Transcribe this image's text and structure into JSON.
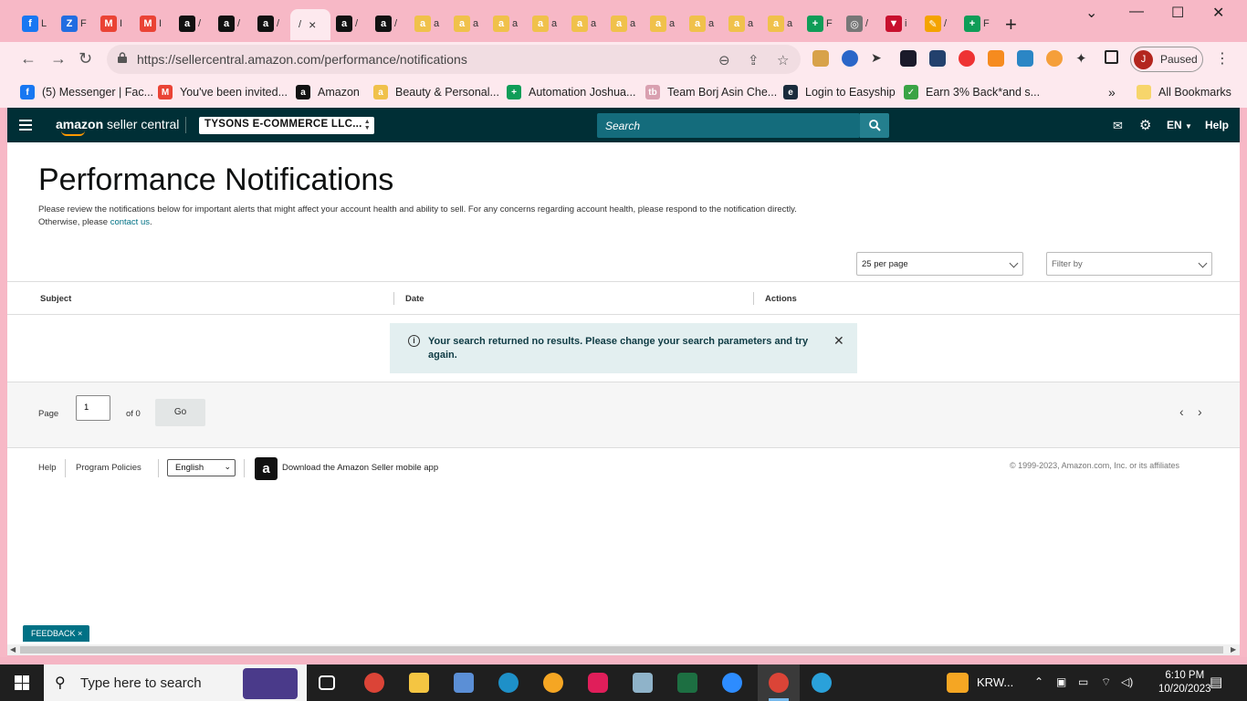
{
  "browser": {
    "tabs": [
      {
        "icon": "facebook-icon",
        "label": "L",
        "color": "#1877f2",
        "glyph": "f"
      },
      {
        "icon": "zoho-icon",
        "label": "F",
        "color": "#226de1",
        "glyph": "Z"
      },
      {
        "icon": "gmail-icon",
        "label": "I",
        "color": "#ea4335",
        "glyph": "M"
      },
      {
        "icon": "gmail-icon",
        "label": "I",
        "color": "#ea4335",
        "glyph": "M"
      },
      {
        "icon": "amazon-icon",
        "label": "/",
        "color": "#111111",
        "glyph": "a"
      },
      {
        "icon": "amazon-icon",
        "label": "/",
        "color": "#111111",
        "glyph": "a"
      },
      {
        "icon": "amazon-icon",
        "label": "/",
        "color": "#111111",
        "glyph": "a"
      },
      {
        "icon": "amazon-icon",
        "label": "/",
        "color": "#111111",
        "glyph": "a"
      },
      {
        "icon": "amazon-icon",
        "label": "/",
        "color": "#111111",
        "glyph": "a"
      },
      {
        "icon": "amazon-smile-icon",
        "label": "a",
        "color": "#f0c14b",
        "glyph": "a"
      },
      {
        "icon": "amazon-smile-icon",
        "label": "a",
        "color": "#f0c14b",
        "glyph": "a"
      },
      {
        "icon": "amazon-smile-icon",
        "label": "a",
        "color": "#f0c14b",
        "glyph": "a"
      },
      {
        "icon": "amazon-smile-icon",
        "label": "a",
        "color": "#f0c14b",
        "glyph": "a"
      },
      {
        "icon": "amazon-smile-icon",
        "label": "a",
        "color": "#f0c14b",
        "glyph": "a"
      },
      {
        "icon": "amazon-smile-icon",
        "label": "a",
        "color": "#f0c14b",
        "glyph": "a"
      },
      {
        "icon": "amazon-smile-icon",
        "label": "a",
        "color": "#f0c14b",
        "glyph": "a"
      },
      {
        "icon": "amazon-smile-icon",
        "label": "a",
        "color": "#f0c14b",
        "glyph": "a"
      },
      {
        "icon": "amazon-smile-icon",
        "label": "a",
        "color": "#f0c14b",
        "glyph": "a"
      },
      {
        "icon": "amazon-smile-icon",
        "label": "a",
        "color": "#f0c14b",
        "glyph": "a"
      },
      {
        "icon": "sheets-icon",
        "label": "F",
        "color": "#0f9d58",
        "glyph": "+"
      },
      {
        "icon": "globe-icon",
        "label": "/",
        "color": "#777777",
        "glyph": "◎"
      },
      {
        "icon": "tabs-icon",
        "label": "i",
        "color": "#c8102e",
        "glyph": "▼"
      },
      {
        "icon": "pencil-icon",
        "label": "/",
        "color": "#f4a300",
        "glyph": "✎"
      },
      {
        "icon": "sheets-icon",
        "label": "F",
        "color": "#0f9d58",
        "glyph": "+"
      }
    ],
    "active_tab_close": "×",
    "new_tab": "+",
    "url": "https://sellercentral.amazon.com/performance/notifications",
    "profile_initial": "J",
    "profile_status": "Paused",
    "bookmarks": [
      {
        "label": "(5) Messenger | Fac...",
        "icon": "facebook-icon",
        "color": "#1877f2",
        "glyph": "f"
      },
      {
        "label": "You've been invited...",
        "icon": "gmail-icon",
        "color": "#ea4335",
        "glyph": "M"
      },
      {
        "label": "Amazon",
        "icon": "amazon-icon",
        "color": "#111111",
        "glyph": "a"
      },
      {
        "label": "Beauty & Personal...",
        "icon": "amazon-smile-icon",
        "color": "#f0c14b",
        "glyph": "a"
      },
      {
        "label": "Automation Joshua...",
        "icon": "sheets-icon",
        "color": "#0f9d58",
        "glyph": "+"
      },
      {
        "label": "Team Borj Asin Che...",
        "icon": "tb-icon",
        "color": "#d9a0b0",
        "glyph": "tb"
      },
      {
        "label": "Login to Easyship",
        "icon": "easyship-icon",
        "color": "#1a2b3c",
        "glyph": "e"
      },
      {
        "label": "Earn 3% Back*and s...",
        "icon": "earn-icon",
        "color": "#3aa345",
        "glyph": "✓"
      }
    ],
    "bookmarks_more": "»",
    "all_bookmarks": "All Bookmarks"
  },
  "seller_central": {
    "logo_brand": "amazon",
    "logo_suffix": " seller central",
    "store": "TYSONS E-COMMERCE LLC...",
    "search_placeholder": "Search",
    "language": "EN",
    "help": "Help"
  },
  "page": {
    "title": "Performance Notifications",
    "description": "Please review the notifications below for important alerts that might affect your account health and ability to sell. For any concerns regarding account health, please respond to the notification directly. Otherwise, please ",
    "contact_link": "contact us",
    "description_end": ".",
    "per_page": "25 per page",
    "filter_placeholder": "Filter by",
    "columns": [
      "Subject",
      "Date",
      "Actions"
    ],
    "alert_message": "Your search returned no results. Please change your search parameters and try again.",
    "pager": {
      "page_label": "Page",
      "page_value": "1",
      "of_label": "of 0",
      "go_label": "Go"
    }
  },
  "footer": {
    "help": "Help",
    "program_policies": "Program Policies",
    "language": "English",
    "app_download": "Download the Amazon Seller mobile app",
    "copyright": "© 1999-2023, Amazon.com, Inc. or its affiliates"
  },
  "feedback": {
    "label": "FEEDBACK",
    "close": "×"
  },
  "taskbar": {
    "search_placeholder": "Type here to search",
    "weather": "KRW...",
    "time": "6:10 PM",
    "date": "10/20/2023"
  }
}
